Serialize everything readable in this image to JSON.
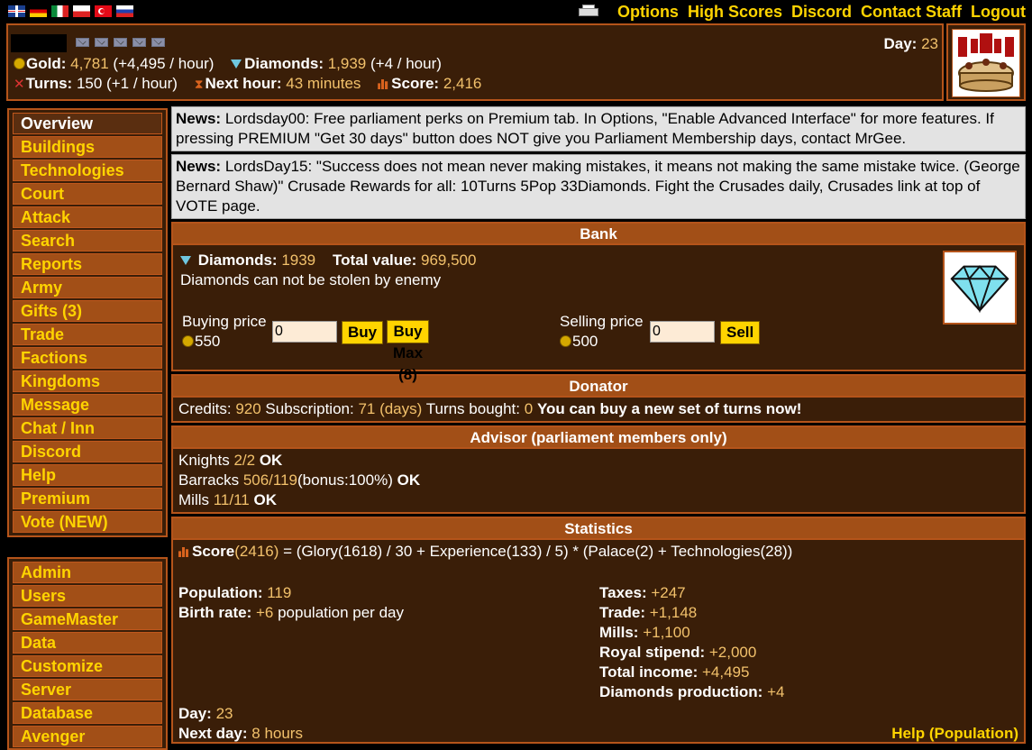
{
  "topnav": {
    "options": "Options",
    "high_scores": "High Scores",
    "discord": "Discord",
    "contact_staff": "Contact Staff",
    "logout": "Logout"
  },
  "header": {
    "gold_label": "Gold:",
    "gold_value": "4,781",
    "gold_rate": "(+4,495 / hour)",
    "diamonds_label": "Diamonds:",
    "diamonds_value": "1,939",
    "diamonds_rate": "(+4 / hour)",
    "turns_label": "Turns:",
    "turns_value": "150",
    "turns_rate": "(+1 / hour)",
    "next_hour_label": "Next hour:",
    "next_hour_value": "43 minutes",
    "score_label": "Score:",
    "score_value": "2,416",
    "day_label": "Day:",
    "day_value": "23"
  },
  "sidebar": {
    "items": [
      {
        "label": "Overview"
      },
      {
        "label": "Buildings"
      },
      {
        "label": "Technologies"
      },
      {
        "label": "Court"
      },
      {
        "label": "Attack"
      },
      {
        "label": "Search"
      },
      {
        "label": "Reports"
      },
      {
        "label": "Army"
      },
      {
        "label": "Gifts (3)"
      },
      {
        "label": "Trade"
      },
      {
        "label": "Factions"
      },
      {
        "label": "Kingdoms"
      },
      {
        "label": "Message"
      },
      {
        "label": "Chat / Inn"
      },
      {
        "label": "Discord"
      },
      {
        "label": "Help"
      },
      {
        "label": "Premium"
      },
      {
        "label": "Vote (NEW)"
      }
    ],
    "admin_items": [
      {
        "label": "Admin"
      },
      {
        "label": "Users"
      },
      {
        "label": "GameMaster"
      },
      {
        "label": "Data"
      },
      {
        "label": "Customize"
      },
      {
        "label": "Server"
      },
      {
        "label": "Database"
      },
      {
        "label": "Avenger"
      }
    ]
  },
  "news": [
    {
      "label": "News:",
      "text": "Lordsday00: Free parliament perks on Premium tab. In Options, \"Enable Advanced Interface\" for more features. If pressing PREMIUM \"Get 30 days\" button does NOT give you Parliament Membership days, contact MrGee."
    },
    {
      "label": "News:",
      "text": "LordsDay15: \"Success does not mean never making mistakes, it means not making the same mistake twice. (George Bernard Shaw)\" Crusade Rewards for all: 10Turns 5Pop 33Diamonds. Fight the Crusades daily, Crusades link at top of VOTE page."
    }
  ],
  "bank": {
    "title": "Bank",
    "diamonds_label": "Diamonds:",
    "diamonds_value": "1939",
    "total_label": "Total value:",
    "total_value": "969,500",
    "note": "Diamonds can not be stolen by enemy",
    "buy_label": "Buying price",
    "buy_price": "550",
    "buy_input": "0",
    "buy_button": "Buy",
    "buy_max_button": "Buy Max (8)",
    "sell_label": "Selling price",
    "sell_price": "500",
    "sell_input": "0",
    "sell_button": "Sell"
  },
  "donator": {
    "title": "Donator",
    "credits_label": "Credits:",
    "credits_value": "920",
    "subscription_label": "Subscription:",
    "subscription_value": "71 (days)",
    "turns_bought_label": "Turns bought:",
    "turns_bought_value": "0",
    "message": "You can buy a new set of turns now!"
  },
  "advisor": {
    "title": "Advisor (parliament members only)",
    "rows": [
      {
        "label": "Knights",
        "value": "2/2",
        "extra": "",
        "status": "OK"
      },
      {
        "label": "Barracks",
        "value": "506/119",
        "extra": "(bonus:100%)",
        "status": "OK"
      },
      {
        "label": "Mills",
        "value": "11/11",
        "extra": "",
        "status": "OK"
      }
    ]
  },
  "statistics": {
    "title": "Statistics",
    "formula_label": "Score",
    "formula_score": "(2416)",
    "formula_rest": "= (Glory(1618) / 30 + Experience(133) / 5) * (Palace(2) + Technologies(28))",
    "population_label": "Population:",
    "population_value": "119",
    "birth_label": "Birth rate:",
    "birth_value": "+6",
    "birth_suffix": "population per day",
    "taxes_label": "Taxes:",
    "taxes_value": "+247",
    "trade_label": "Trade:",
    "trade_value": "+1,148",
    "mills_label": "Mills:",
    "mills_value": "+1,100",
    "stipend_label": "Royal stipend:",
    "stipend_value": "+2,000",
    "income_label": "Total income:",
    "income_value": "+4,495",
    "diamprod_label": "Diamonds production:",
    "diamprod_value": "+4",
    "day_label": "Day:",
    "day_value": "23",
    "nextday_label": "Next day:",
    "nextday_value": "8 hours",
    "help_link": "Help (Population)"
  }
}
